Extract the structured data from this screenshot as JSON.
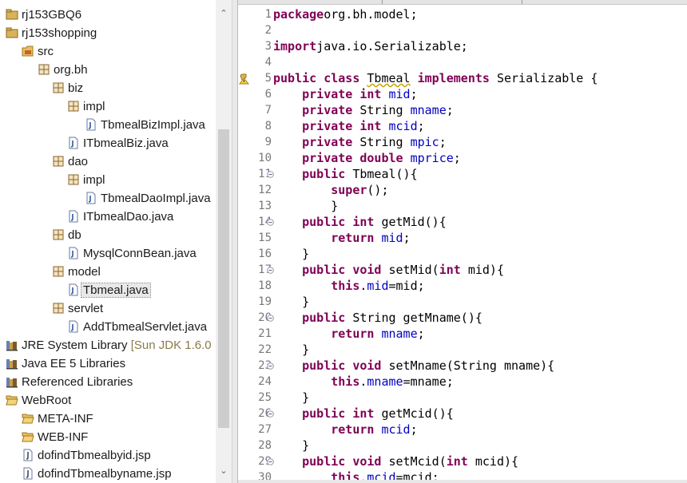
{
  "explorer": {
    "items": [
      {
        "label": "rj153GBQ6",
        "depth": 0,
        "icon": "project-icon"
      },
      {
        "label": "rj153shopping",
        "depth": 0,
        "icon": "project-icon"
      },
      {
        "label": "src",
        "depth": 1,
        "icon": "source-folder-icon"
      },
      {
        "label": "org.bh",
        "depth": 2,
        "icon": "package-icon"
      },
      {
        "label": "biz",
        "depth": 3,
        "icon": "package-icon"
      },
      {
        "label": "impl",
        "depth": 4,
        "icon": "package-icon"
      },
      {
        "label": "TbmealBizImpl.java",
        "depth": 5,
        "icon": "java-file-icon"
      },
      {
        "label": "ITbmealBiz.java",
        "depth": 4,
        "icon": "java-file-icon"
      },
      {
        "label": "dao",
        "depth": 3,
        "icon": "package-icon"
      },
      {
        "label": "impl",
        "depth": 4,
        "icon": "package-icon"
      },
      {
        "label": "TbmealDaoImpl.java",
        "depth": 5,
        "icon": "java-file-icon"
      },
      {
        "label": "ITbmealDao.java",
        "depth": 4,
        "icon": "java-file-icon"
      },
      {
        "label": "db",
        "depth": 3,
        "icon": "package-icon"
      },
      {
        "label": "MysqlConnBean.java",
        "depth": 4,
        "icon": "java-file-icon"
      },
      {
        "label": "model",
        "depth": 3,
        "icon": "package-icon"
      },
      {
        "label": "Tbmeal.java",
        "depth": 4,
        "icon": "java-file-icon",
        "selected": true
      },
      {
        "label": "servlet",
        "depth": 3,
        "icon": "package-icon"
      },
      {
        "label": "AddTbmealServlet.java",
        "depth": 4,
        "icon": "java-file-icon"
      },
      {
        "label": "JRE System Library",
        "extra": " [Sun JDK 1.6.0",
        "depth": 0,
        "icon": "library-icon"
      },
      {
        "label": "Java EE 5 Libraries",
        "depth": 0,
        "icon": "library-icon"
      },
      {
        "label": "Referenced Libraries",
        "depth": 0,
        "icon": "library-icon"
      },
      {
        "label": "WebRoot",
        "depth": 0,
        "icon": "folder-open-icon"
      },
      {
        "label": "META-INF",
        "depth": 1,
        "icon": "folder-open-icon"
      },
      {
        "label": "WEB-INF",
        "depth": 1,
        "icon": "folder-open-icon"
      },
      {
        "label": "dofindTbmealbyid.jsp",
        "depth": 1,
        "icon": "jsp-file-icon"
      },
      {
        "label": "dofindTbmealbyname.jsp",
        "depth": 1,
        "icon": "jsp-file-icon"
      }
    ]
  },
  "scrollbar": {
    "up_glyph": "⌃",
    "down_glyph": "⌄"
  },
  "editor": {
    "lines": [
      {
        "n": "1",
        "t": [
          [
            "kw",
            "package"
          ],
          [
            "",
            "org.bh.model;"
          ]
        ]
      },
      {
        "n": "2",
        "t": []
      },
      {
        "n": "3",
        "t": [
          [
            "kw",
            "import"
          ],
          [
            "",
            "java.io.Serializable;"
          ]
        ]
      },
      {
        "n": "4",
        "t": []
      },
      {
        "n": "5",
        "t": [
          [
            "kw",
            "public"
          ],
          [
            "",
            " "
          ],
          [
            "kw",
            "class"
          ],
          [
            "",
            " "
          ],
          [
            "warn",
            "Tbmeal"
          ],
          [
            "",
            " "
          ],
          [
            "kw",
            "implements"
          ],
          [
            "",
            "",
            " Serializable {"
          ]
        ],
        "marker": "warning"
      },
      {
        "n": "6",
        "t": [
          [
            "",
            "    "
          ],
          [
            "kw",
            "private"
          ],
          [
            "",
            " "
          ],
          [
            "kw",
            "int"
          ],
          [
            "",
            " "
          ],
          [
            "fld",
            "mid"
          ],
          [
            "",
            ";"
          ]
        ]
      },
      {
        "n": "7",
        "t": [
          [
            "",
            "    "
          ],
          [
            "kw",
            "private"
          ],
          [
            "",
            " String "
          ],
          [
            "fld",
            "mname"
          ],
          [
            "",
            ";"
          ]
        ]
      },
      {
        "n": "8",
        "t": [
          [
            "",
            "    "
          ],
          [
            "kw",
            "private"
          ],
          [
            "",
            " "
          ],
          [
            "kw",
            "int"
          ],
          [
            "",
            " "
          ],
          [
            "fld",
            "mcid"
          ],
          [
            "",
            ";"
          ]
        ]
      },
      {
        "n": "9",
        "t": [
          [
            "",
            "    "
          ],
          [
            "kw",
            "private"
          ],
          [
            "",
            " String "
          ],
          [
            "fld",
            "mpic"
          ],
          [
            "",
            ";"
          ]
        ]
      },
      {
        "n": "10",
        "t": [
          [
            "",
            "    "
          ],
          [
            "kw",
            "private"
          ],
          [
            "",
            " "
          ],
          [
            "kw",
            "double"
          ],
          [
            "",
            " "
          ],
          [
            "fld",
            "mprice"
          ],
          [
            "",
            ";"
          ]
        ]
      },
      {
        "n": "11",
        "t": [
          [
            "",
            "    "
          ],
          [
            "kw",
            "public"
          ],
          [
            "",
            " Tbmeal(){"
          ]
        ],
        "fold": true
      },
      {
        "n": "12",
        "t": [
          [
            "",
            "        "
          ],
          [
            "kw",
            "super"
          ],
          [
            "",
            "();"
          ]
        ]
      },
      {
        "n": "13",
        "t": [
          [
            "",
            "        }"
          ]
        ]
      },
      {
        "n": "14",
        "t": [
          [
            "",
            "    "
          ],
          [
            "kw",
            "public"
          ],
          [
            "",
            " "
          ],
          [
            "kw",
            "int"
          ],
          [
            "",
            " getMid(){"
          ]
        ],
        "fold": true
      },
      {
        "n": "15",
        "t": [
          [
            "",
            "        "
          ],
          [
            "kw",
            "return"
          ],
          [
            "",
            " "
          ],
          [
            "fld",
            "mid"
          ],
          [
            "",
            ";"
          ]
        ]
      },
      {
        "n": "16",
        "t": [
          [
            "",
            "    }"
          ]
        ]
      },
      {
        "n": "17",
        "t": [
          [
            "",
            "    "
          ],
          [
            "kw",
            "public"
          ],
          [
            "",
            " "
          ],
          [
            "kw",
            "void"
          ],
          [
            "",
            " setMid("
          ],
          [
            "kw",
            "int"
          ],
          [
            "",
            " mid){"
          ]
        ],
        "fold": true
      },
      {
        "n": "18",
        "t": [
          [
            "",
            "        "
          ],
          [
            "kw",
            "this"
          ],
          [
            "",
            "."
          ],
          [
            "fld",
            "mid"
          ],
          [
            "",
            "=mid;"
          ]
        ]
      },
      {
        "n": "19",
        "t": [
          [
            "",
            "    }"
          ]
        ]
      },
      {
        "n": "20",
        "t": [
          [
            "",
            "    "
          ],
          [
            "kw",
            "public"
          ],
          [
            "",
            " String getMname(){"
          ]
        ],
        "fold": true
      },
      {
        "n": "21",
        "t": [
          [
            "",
            "        "
          ],
          [
            "kw",
            "return"
          ],
          [
            "",
            " "
          ],
          [
            "fld",
            "mname"
          ],
          [
            "",
            ";"
          ]
        ]
      },
      {
        "n": "22",
        "t": [
          [
            "",
            "    }"
          ]
        ]
      },
      {
        "n": "23",
        "t": [
          [
            "",
            "    "
          ],
          [
            "kw",
            "public"
          ],
          [
            "",
            " "
          ],
          [
            "kw",
            "void"
          ],
          [
            "",
            " setMname(String mname){"
          ]
        ],
        "fold": true
      },
      {
        "n": "24",
        "t": [
          [
            "",
            "        "
          ],
          [
            "kw",
            "this"
          ],
          [
            "",
            "."
          ],
          [
            "fld",
            "mname"
          ],
          [
            "",
            "=mname;"
          ]
        ]
      },
      {
        "n": "25",
        "t": [
          [
            "",
            "    }"
          ]
        ]
      },
      {
        "n": "26",
        "t": [
          [
            "",
            "    "
          ],
          [
            "kw",
            "public"
          ],
          [
            "",
            " "
          ],
          [
            "kw",
            "int"
          ],
          [
            "",
            " getMcid(){"
          ]
        ],
        "fold": true
      },
      {
        "n": "27",
        "t": [
          [
            "",
            "        "
          ],
          [
            "kw",
            "return"
          ],
          [
            "",
            " "
          ],
          [
            "fld",
            "mcid"
          ],
          [
            "",
            ";"
          ]
        ]
      },
      {
        "n": "28",
        "t": [
          [
            "",
            "    }"
          ]
        ]
      },
      {
        "n": "29",
        "t": [
          [
            "",
            "    "
          ],
          [
            "kw",
            "public"
          ],
          [
            "",
            " "
          ],
          [
            "kw",
            "void"
          ],
          [
            "",
            " setMcid("
          ],
          [
            "kw",
            "int"
          ],
          [
            "",
            " mcid){"
          ]
        ],
        "fold": true
      },
      {
        "n": "30",
        "t": [
          [
            "",
            "        "
          ],
          [
            "kw",
            "this"
          ],
          [
            "",
            "."
          ],
          [
            "fld",
            "mcid"
          ],
          [
            "",
            "=mcid;"
          ]
        ]
      }
    ]
  },
  "colors": {
    "keyword": "#7f0055",
    "field": "#0000c0",
    "line_number": "#787878",
    "selection": "#e8e8e8"
  }
}
